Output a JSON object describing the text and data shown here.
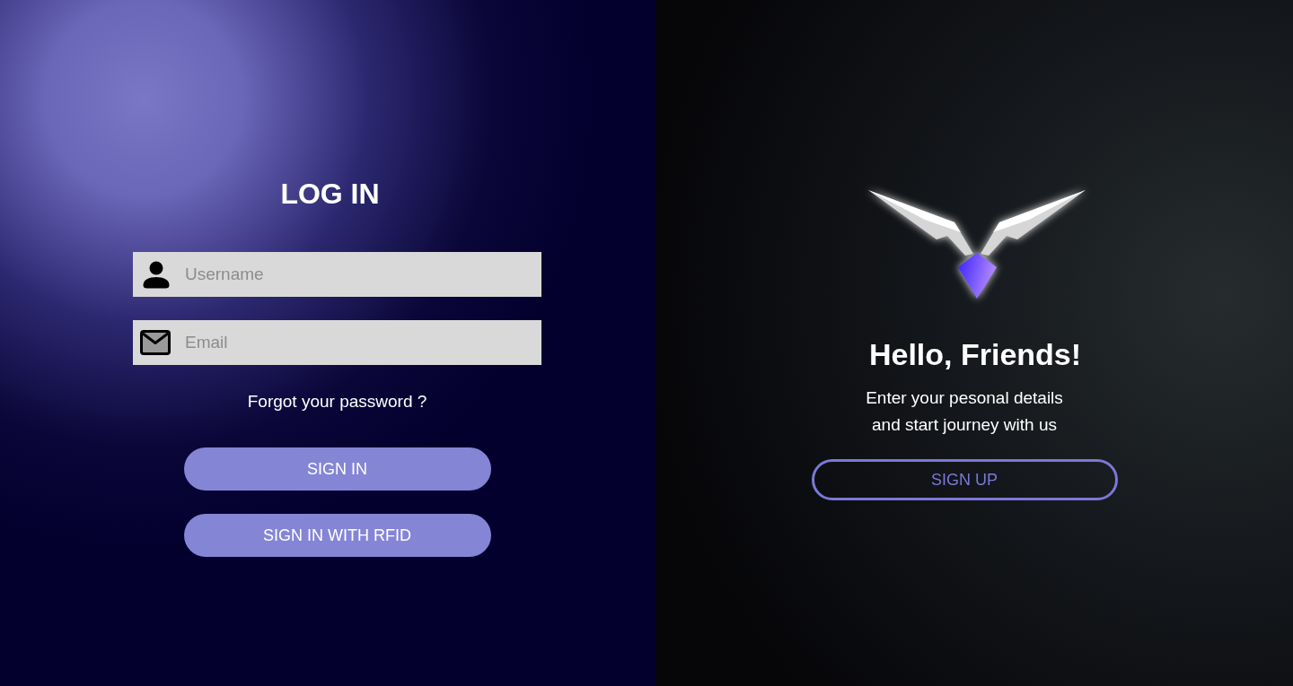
{
  "login": {
    "title": "LOG IN",
    "fields": [
      {
        "kind": "user",
        "placeholder": "Username"
      },
      {
        "kind": "email",
        "placeholder": "Email"
      }
    ],
    "forgot_link": "Forgot your password ?",
    "buttons": [
      "SIGN IN",
      "SIGN IN WITH RFID"
    ]
  },
  "welcome": {
    "heading": "Hello, Friends!",
    "text_lines": [
      "Enter your pesonal details",
      "and start journey with us"
    ],
    "button": "SIGN UP"
  }
}
